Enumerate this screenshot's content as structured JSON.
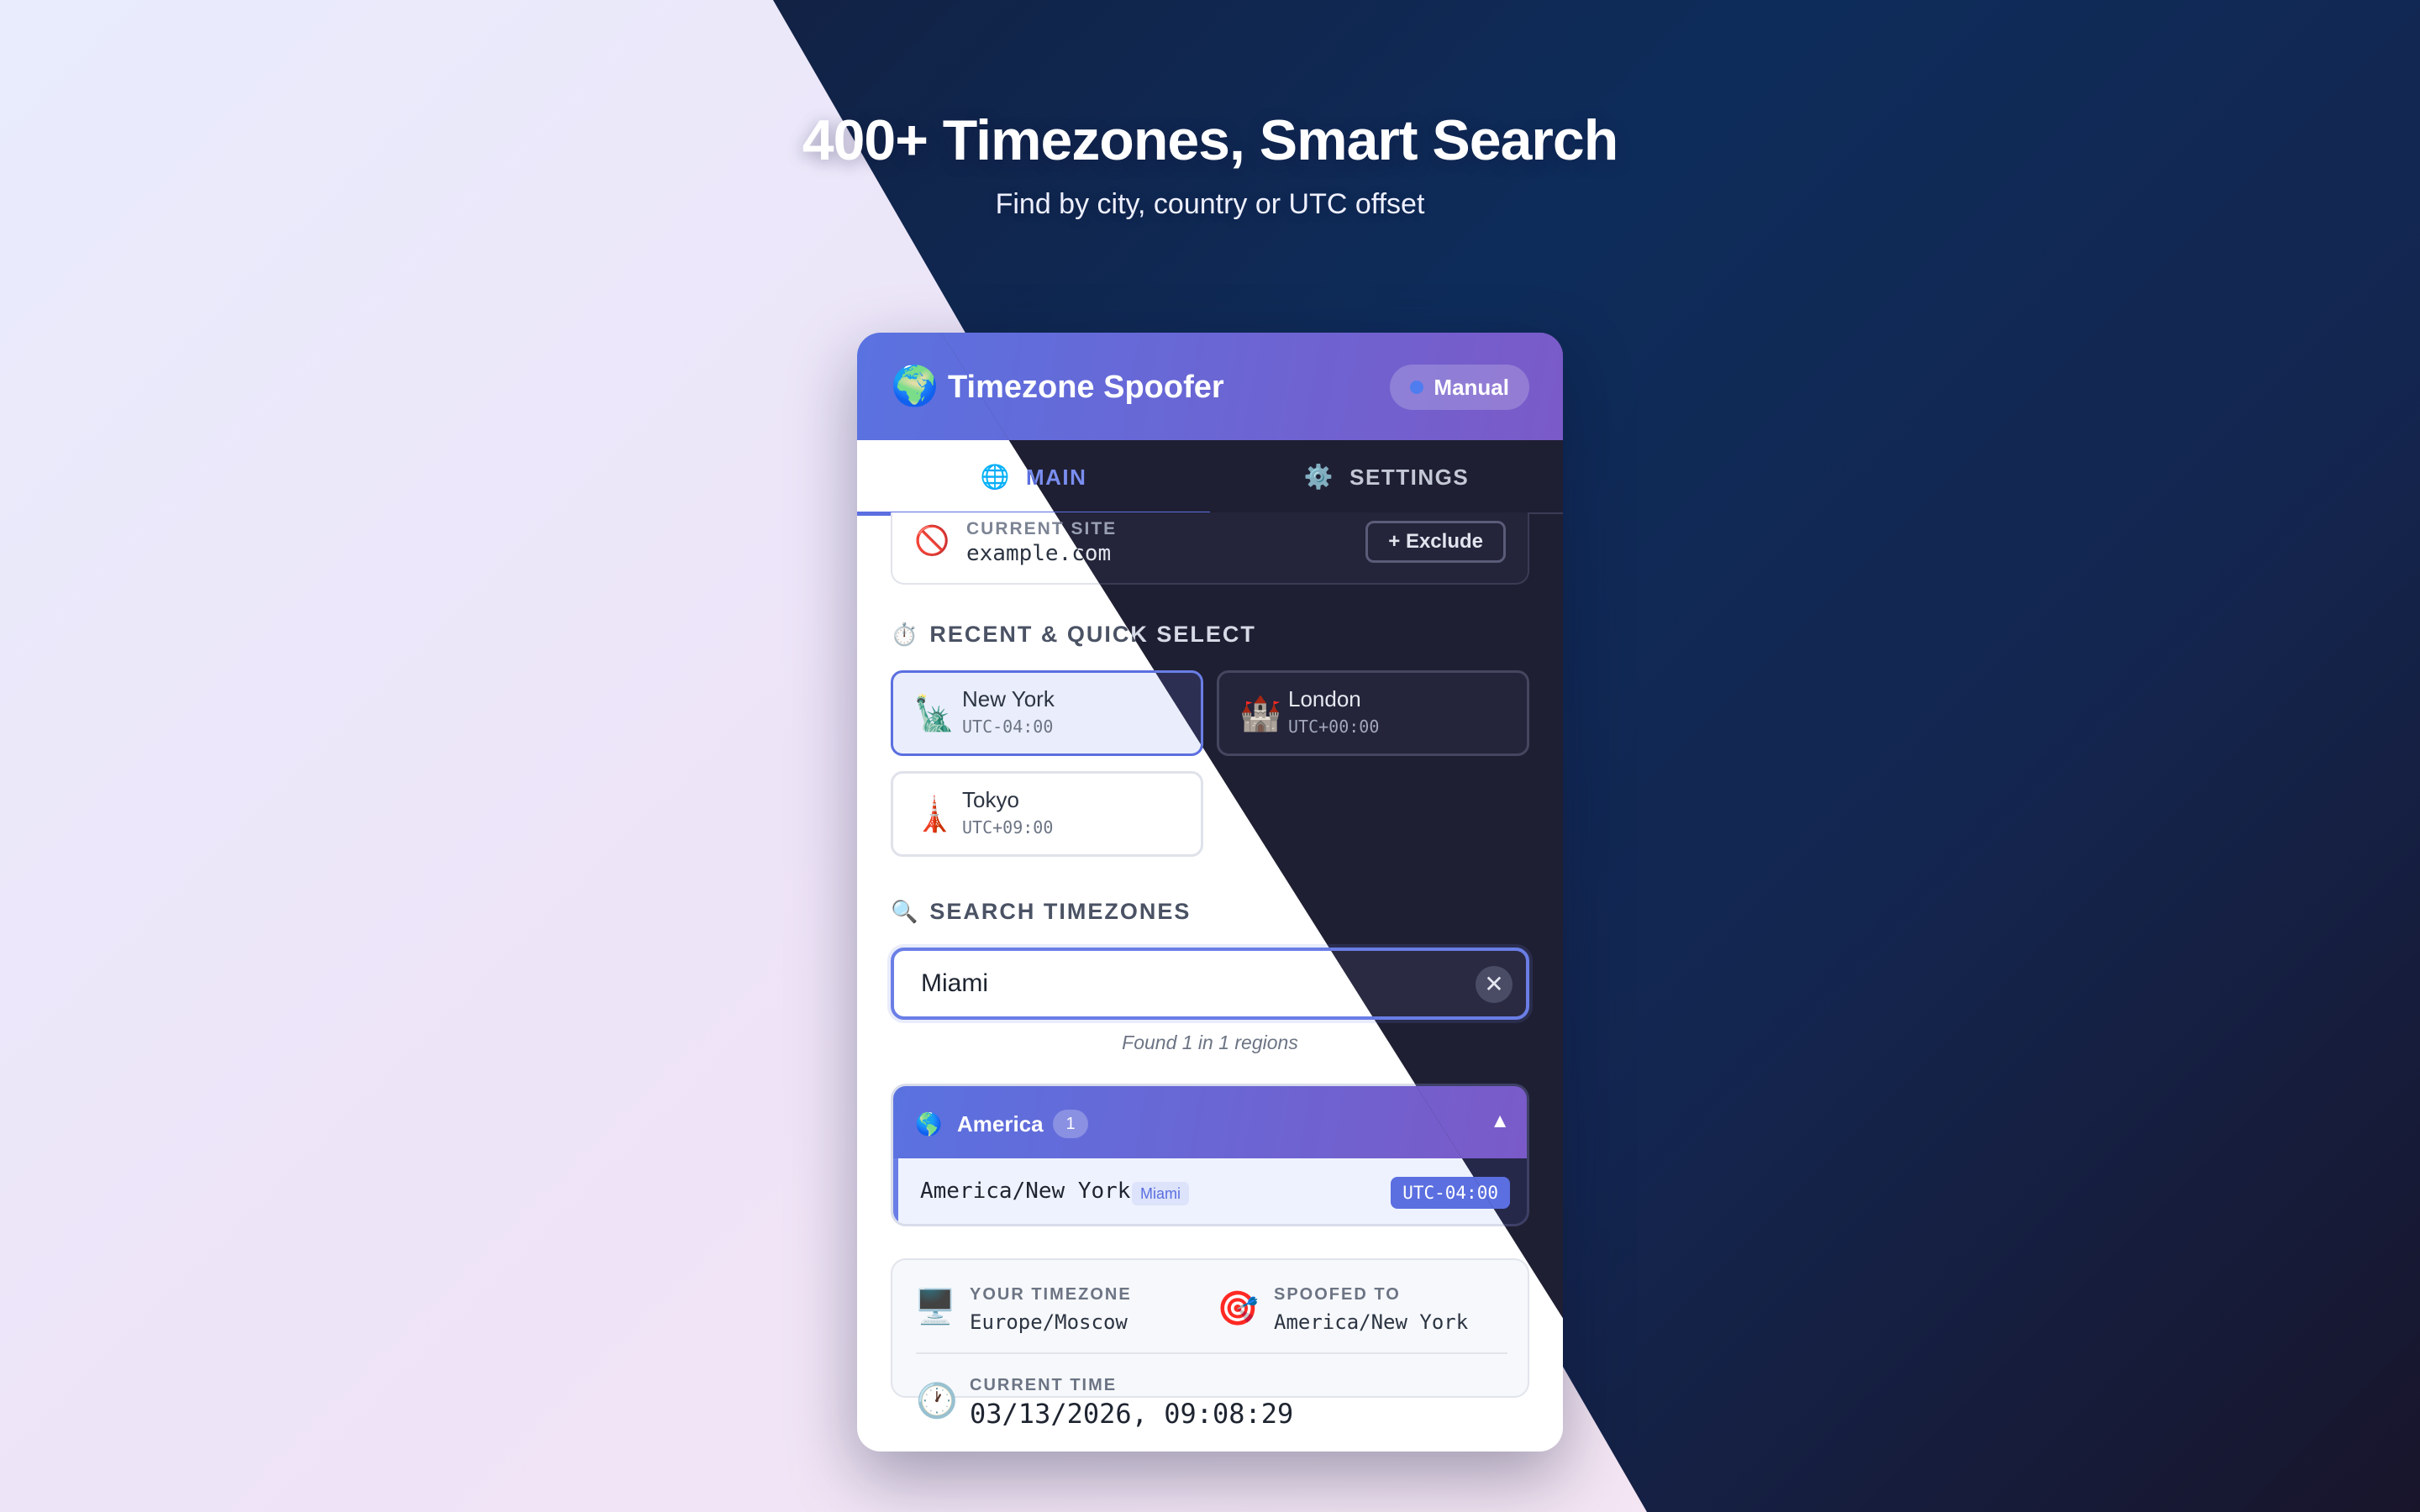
{
  "hero": {
    "title": "400+ Timezones, Smart Search",
    "subtitle": "Find by city, country or UTC offset"
  },
  "app": {
    "logo_icon": "🌍",
    "title": "Timezone Spoofer",
    "mode": "Manual"
  },
  "tabs": {
    "main": {
      "icon": "🌐",
      "label": "MAIN"
    },
    "settings": {
      "icon": "⚙️",
      "label": "SETTINGS"
    }
  },
  "site": {
    "icon": "🚫",
    "label": "CURRENT SITE",
    "domain": "example.com",
    "exclude_label": "+ Exclude"
  },
  "quick_select": {
    "icon": "⏱️",
    "title": "RECENT & QUICK SELECT",
    "items": [
      {
        "emoji": "🗽",
        "city": "New York",
        "offset": "UTC-04:00",
        "active": true
      },
      {
        "emoji": "🏰",
        "city": "London",
        "offset": "UTC+00:00",
        "active": false
      },
      {
        "emoji": "🗼",
        "city": "Tokyo",
        "offset": "UTC+09:00",
        "active": false
      }
    ]
  },
  "search": {
    "icon": "🔍",
    "title": "SEARCH TIMEZONES",
    "value": "Miami",
    "clear_icon": "✕",
    "found_text": "Found 1 in 1 regions"
  },
  "region": {
    "icon": "🌎",
    "name": "America",
    "count": "1",
    "toggle_icon": "▲",
    "result": {
      "name": "America/New York",
      "match": "Miami",
      "offset": "UTC-04:00"
    }
  },
  "info": {
    "your": {
      "emoji": "🖥️",
      "label": "YOUR TIMEZONE",
      "value": "Europe/Moscow"
    },
    "spoofed": {
      "emoji": "🎯",
      "label": "SPOOFED TO",
      "value": "America/New York"
    },
    "time": {
      "emoji": "🕐",
      "label": "CURRENT TIME",
      "value": "03/13/2026, 09:08:29"
    }
  },
  "colors": {
    "accent": "#5b6fe0",
    "header_gradient_start": "#5a72e0",
    "header_gradient_end": "#7a5ac8",
    "dark_panel": "#1f1f33"
  }
}
